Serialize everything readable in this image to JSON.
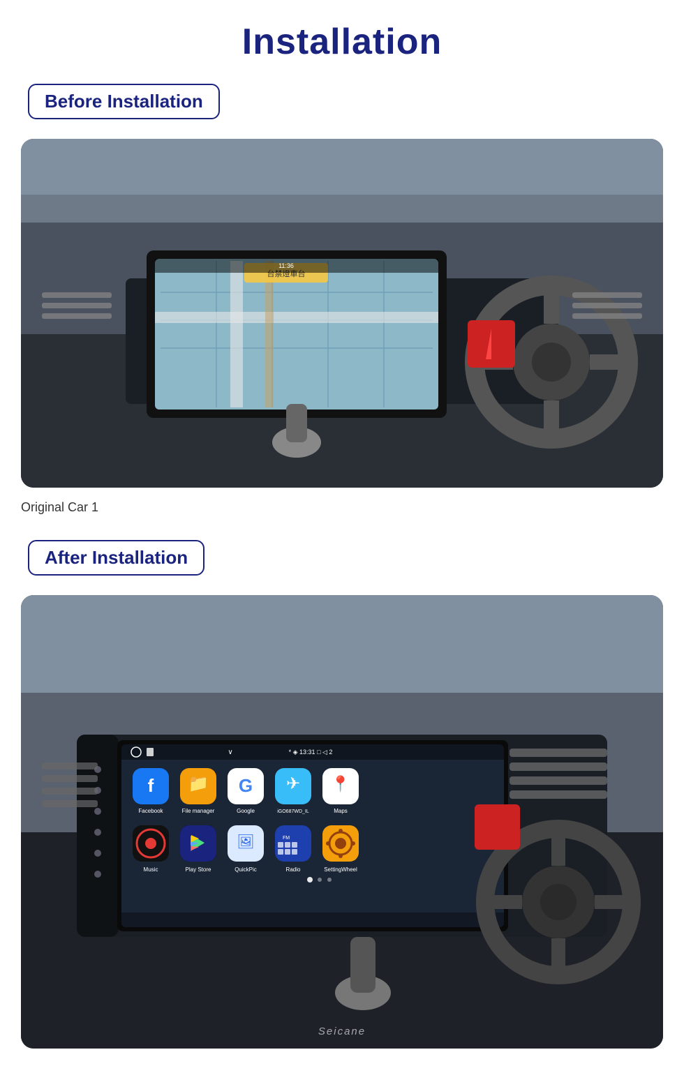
{
  "page": {
    "title": "Installation",
    "before_label": "Before Installation",
    "after_label": "After Installation",
    "caption": "Original Car  1",
    "seicane": "Seicane"
  },
  "status_bar": {
    "time": "13:31",
    "icons": "* ◈  □  ◁  2"
  },
  "apps": [
    {
      "name": "Facebook",
      "icon_class": "facebook-icon",
      "symbol": "f"
    },
    {
      "name": "File manager",
      "icon_class": "filemanager-icon",
      "symbol": "📁"
    },
    {
      "name": "Google",
      "icon_class": "google-icon",
      "symbol": "G"
    },
    {
      "name": "iGO687WD_IL",
      "icon_class": "igo-icon",
      "symbol": "✈"
    },
    {
      "name": "Maps",
      "icon_class": "maps-icon",
      "symbol": "📍"
    },
    {
      "name": "Music",
      "icon_class": "music-icon",
      "symbol": "♪"
    },
    {
      "name": "Play Store",
      "icon_class": "playstore-icon",
      "symbol": "▶"
    },
    {
      "name": "QuickPic",
      "icon_class": "quickpic-icon",
      "symbol": "🖼"
    },
    {
      "name": "Radio",
      "icon_class": "radio-icon",
      "symbol": "📻"
    },
    {
      "name": "SettingWheel",
      "icon_class": "settingwheel-icon",
      "symbol": "⚙"
    }
  ]
}
